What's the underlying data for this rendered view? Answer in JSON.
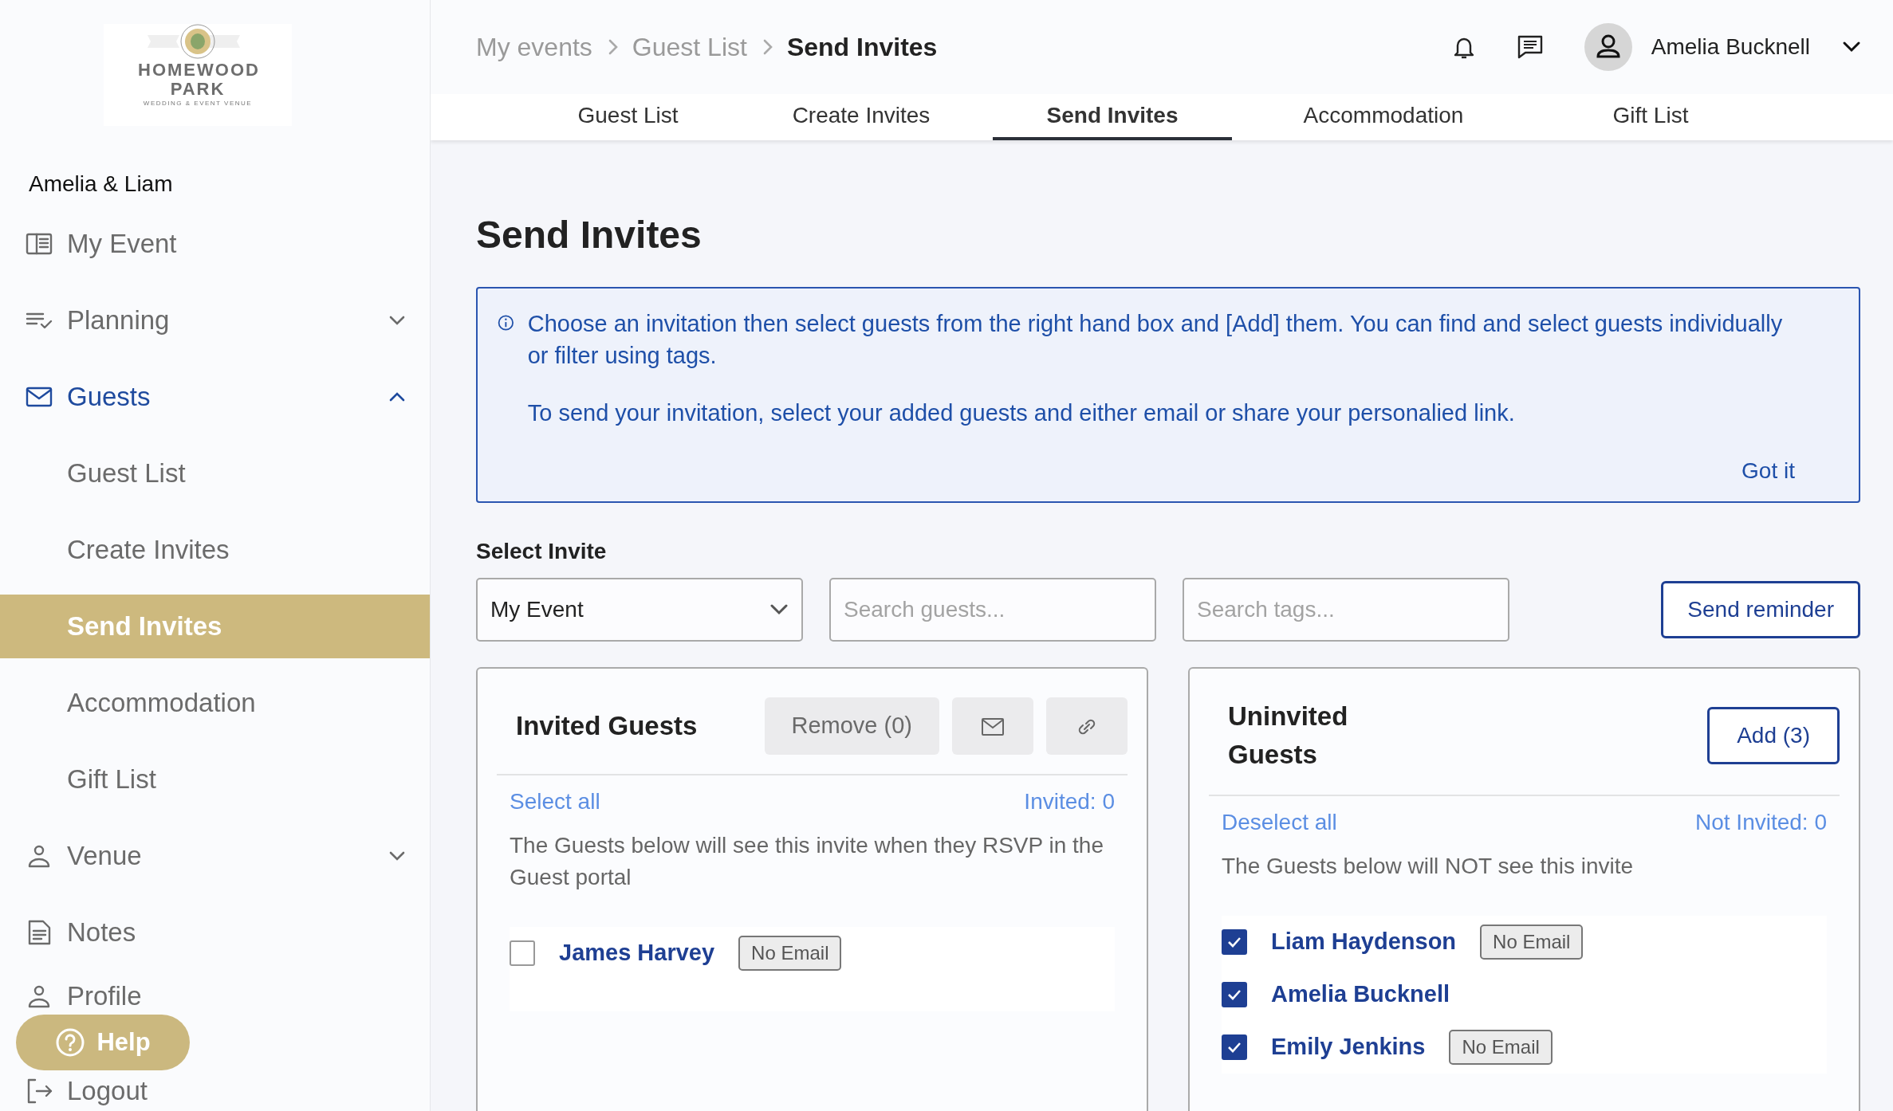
{
  "logo": {
    "name": "HOMEWOOD PARK",
    "tagline": "WEDDING & EVENT VENUE"
  },
  "sidebar": {
    "event_name": "Amelia & Liam",
    "items": [
      {
        "label": "My Event",
        "kind": "link",
        "selected": false
      },
      {
        "label": "Planning",
        "kind": "group",
        "expanded": false,
        "selected": false
      },
      {
        "label": "Guests",
        "kind": "group",
        "expanded": true,
        "selected": false,
        "children": [
          {
            "label": "Guest List",
            "selected": false
          },
          {
            "label": "Create Invites",
            "selected": false
          },
          {
            "label": "Send Invites",
            "selected": true
          },
          {
            "label": "Accommodation",
            "selected": false
          },
          {
            "label": "Gift List",
            "selected": false
          }
        ]
      },
      {
        "label": "Venue",
        "kind": "group",
        "expanded": false,
        "selected": false
      },
      {
        "label": "Notes",
        "kind": "link",
        "selected": false
      },
      {
        "label": "Profile",
        "kind": "link",
        "selected": false
      },
      {
        "label": "Logout",
        "kind": "link",
        "selected": false
      }
    ]
  },
  "help_button": {
    "label": "Help"
  },
  "breadcrumbs": [
    {
      "label": "My events",
      "current": false
    },
    {
      "label": "Guest List",
      "current": false
    },
    {
      "label": "Send Invites",
      "current": true
    }
  ],
  "user": {
    "name": "Amelia Bucknell"
  },
  "tabs": [
    {
      "label": "Guest List",
      "selected": false
    },
    {
      "label": "Create Invites",
      "selected": false
    },
    {
      "label": "Send Invites",
      "selected": true
    },
    {
      "label": "Accommodation",
      "selected": false
    },
    {
      "label": "Gift List",
      "selected": false
    }
  ],
  "page_title": "Send Invites",
  "info": {
    "paragraphs": [
      "Choose an invitation then select guests from the right hand box and [Add] them. You can find and select guests individually or filter using tags.",
      "To send your invitation, select your added guests and either email or share your personalied link."
    ],
    "dismiss": "Got it"
  },
  "filters": {
    "label": "Select Invite",
    "invite": "My Event",
    "guest_search": {
      "placeholder": "Search guests..."
    },
    "tag_search": {
      "placeholder": "Search tags..."
    },
    "reminder_button": "Send reminder"
  },
  "panels": [
    {
      "title": "Invited Guests",
      "actions": [
        {
          "kind": "text",
          "label": "Remove (0)"
        },
        {
          "kind": "mail"
        },
        {
          "kind": "link"
        }
      ],
      "select_link": "Select all",
      "count": "Invited: 0",
      "note": "The Guests below will see this invite when they RSVP in the Guest portal",
      "guests": [
        {
          "name": "James Harvey",
          "checked": false,
          "tag": "No Email"
        }
      ]
    },
    {
      "title": "Uninvited Guests",
      "actions": [
        {
          "kind": "text",
          "label": "Add (3)"
        }
      ],
      "select_link": "Deselect all",
      "count": "Not Invited: 0",
      "note": "The Guests below will NOT see this invite",
      "guests": [
        {
          "name": "Liam Haydenson",
          "checked": true,
          "tag": "No Email"
        },
        {
          "name": "Amelia Bucknell",
          "checked": true
        },
        {
          "name": "Emily Jenkins",
          "checked": true,
          "tag": "No Email"
        }
      ]
    }
  ]
}
